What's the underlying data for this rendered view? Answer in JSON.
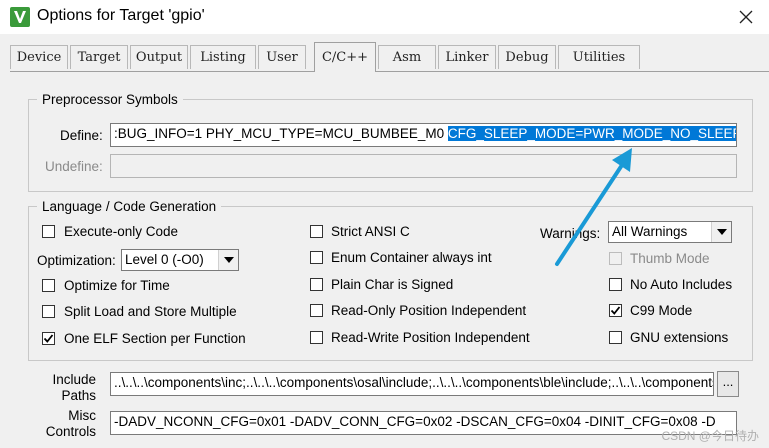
{
  "window": {
    "title": "Options for Target 'gpio'"
  },
  "tabs": [
    {
      "label": "Device"
    },
    {
      "label": "Target"
    },
    {
      "label": "Output"
    },
    {
      "label": "Listing"
    },
    {
      "label": "User"
    },
    {
      "label": "C/C++"
    },
    {
      "label": "Asm"
    },
    {
      "label": "Linker"
    },
    {
      "label": "Debug"
    },
    {
      "label": "Utilities"
    }
  ],
  "active_tab": "C/C++",
  "preprocessor": {
    "legend": "Preprocessor Symbols",
    "define_label": "Define:",
    "define_value_plain": ":BUG_INFO=1 PHY_MCU_TYPE=MCU_BUMBEE_M0 ",
    "define_value_selected": "CFG_SLEEP_MODE=PWR_MODE_NO_SLEEP",
    "undefine_label": "Undefine:",
    "undefine_value": ""
  },
  "codegen": {
    "legend": "Language / Code Generation",
    "execute_only": {
      "label": "Execute-only Code",
      "checked": false
    },
    "optimization_label": "Optimization:",
    "optimization_value": "Level 0 (-O0)",
    "optimize_time": {
      "label": "Optimize for Time",
      "checked": false
    },
    "split_load": {
      "label": "Split Load and Store Multiple",
      "checked": false
    },
    "one_elf": {
      "label": "One ELF Section per Function",
      "checked": true
    },
    "strict_ansi": {
      "label": "Strict ANSI C",
      "checked": false
    },
    "enum_container": {
      "label": "Enum Container always int",
      "checked": false
    },
    "plain_char": {
      "label": "Plain Char is Signed",
      "checked": false
    },
    "ro_pi": {
      "label": "Read-Only Position Independent",
      "checked": false
    },
    "rw_pi": {
      "label": "Read-Write Position Independent",
      "checked": false
    },
    "warnings_label": "Warnings:",
    "warnings_value": "All Warnings",
    "thumb_mode": {
      "label": "Thumb Mode",
      "checked": false,
      "enabled": false
    },
    "no_auto_includes": {
      "label": "No Auto Includes",
      "checked": false
    },
    "c99_mode": {
      "label": "C99 Mode",
      "checked": true
    },
    "gnu_ext": {
      "label": "GNU extensions",
      "checked": false
    }
  },
  "include": {
    "label_line1": "Include",
    "label_line2": "Paths",
    "value": "..\\..\\..\\components\\inc;..\\..\\..\\components\\osal\\include;..\\..\\..\\components\\ble\\include;..\\..\\..\\components",
    "browse_label": "..."
  },
  "misc": {
    "label_line1": "Misc",
    "label_line2": "Controls",
    "value": "-DADV_NCONN_CFG=0x01  -DADV_CONN_CFG=0x02  -DSCAN_CFG=0x04  -DINIT_CFG=0x08  -D"
  },
  "watermark": "CSDN @今日待办",
  "colors": {
    "selection": "#0078d7",
    "arrow": "#1a9ad6",
    "dialog_bg": "#f0f0f0"
  },
  "icons": {
    "app": "keil-uvision-icon",
    "close": "close-icon",
    "check": "checkmark-icon",
    "dropdown": "chevron-down-icon"
  }
}
